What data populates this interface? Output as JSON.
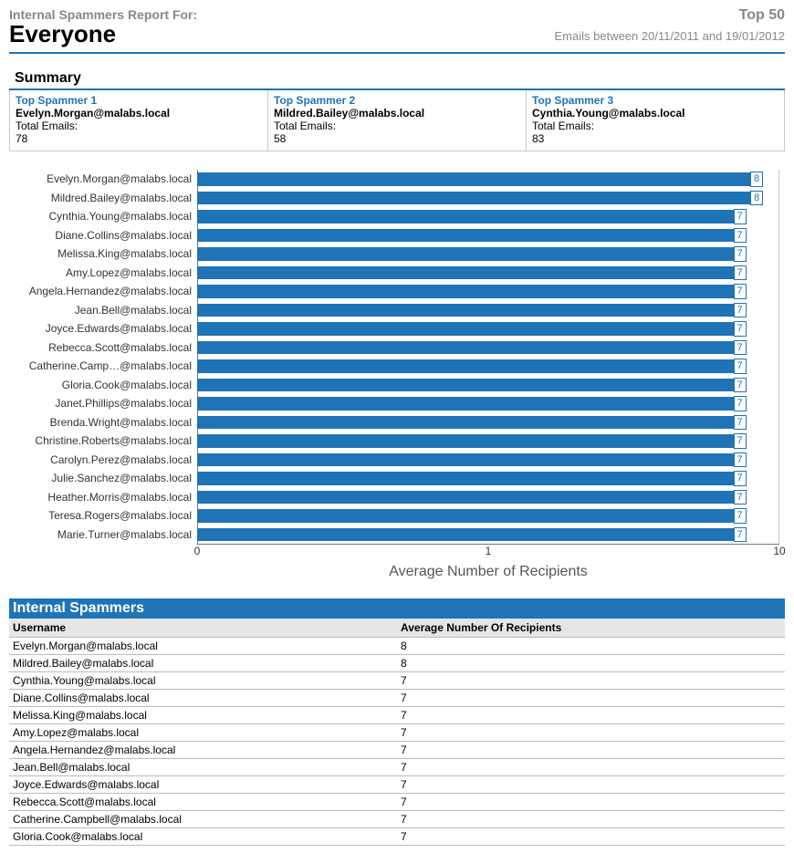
{
  "header": {
    "subtitle": "Internal Spammers Report For:",
    "title": "Everyone",
    "topn": "Top 50",
    "date_range": "Emails between 20/11/2011 and 19/01/2012"
  },
  "summary": {
    "heading": "Summary",
    "cards": [
      {
        "title": "Top Spammer 1",
        "name": "Evelyn.Morgan@malabs.local",
        "label": "Total Emails:",
        "value": "78"
      },
      {
        "title": "Top Spammer 2",
        "name": "Mildred.Bailey@malabs.local",
        "label": "Total Emails:",
        "value": "58"
      },
      {
        "title": "Top Spammer 3",
        "name": "Cynthia.Young@malabs.local",
        "label": "Total Emails:",
        "value": "83"
      }
    ]
  },
  "chart_data": {
    "type": "bar",
    "orientation": "horizontal",
    "xlabel": "Average Number of Recipients",
    "xscale": "log",
    "xlim": [
      0,
      10
    ],
    "xticks": [
      0,
      1,
      10
    ],
    "categories": [
      "Evelyn.Morgan@malabs.local",
      "Mildred.Bailey@malabs.local",
      "Cynthia.Young@malabs.local",
      "Diane.Collins@malabs.local",
      "Melissa.King@malabs.local",
      "Amy.Lopez@malabs.local",
      "Angela.Hernandez@malabs.local",
      "Jean.Bell@malabs.local",
      "Joyce.Edwards@malabs.local",
      "Rebecca.Scott@malabs.local",
      "Catherine.Camp…@malabs.local",
      "Gloria.Cook@malabs.local",
      "Janet.Phillips@malabs.local",
      "Brenda.Wright@malabs.local",
      "Christine.Roberts@malabs.local",
      "Carolyn.Perez@malabs.local",
      "Julie.Sanchez@malabs.local",
      "Heather.Morris@malabs.local",
      "Teresa.Rogers@malabs.local",
      "Marie.Turner@malabs.local"
    ],
    "values": [
      8,
      8,
      7,
      7,
      7,
      7,
      7,
      7,
      7,
      7,
      7,
      7,
      7,
      7,
      7,
      7,
      7,
      7,
      7,
      7
    ]
  },
  "table": {
    "section_title": "Internal Spammers",
    "columns": [
      "Username",
      "Average Number Of Recipients"
    ],
    "rows": [
      [
        "Evelyn.Morgan@malabs.local",
        "8"
      ],
      [
        "Mildred.Bailey@malabs.local",
        "8"
      ],
      [
        "Cynthia.Young@malabs.local",
        "7"
      ],
      [
        "Diane.Collins@malabs.local",
        "7"
      ],
      [
        "Melissa.King@malabs.local",
        "7"
      ],
      [
        "Amy.Lopez@malabs.local",
        "7"
      ],
      [
        "Angela.Hernandez@malabs.local",
        "7"
      ],
      [
        "Jean.Bell@malabs.local",
        "7"
      ],
      [
        "Joyce.Edwards@malabs.local",
        "7"
      ],
      [
        "Rebecca.Scott@malabs.local",
        "7"
      ],
      [
        "Catherine.Campbell@malabs.local",
        "7"
      ],
      [
        "Gloria.Cook@malabs.local",
        "7"
      ]
    ]
  }
}
